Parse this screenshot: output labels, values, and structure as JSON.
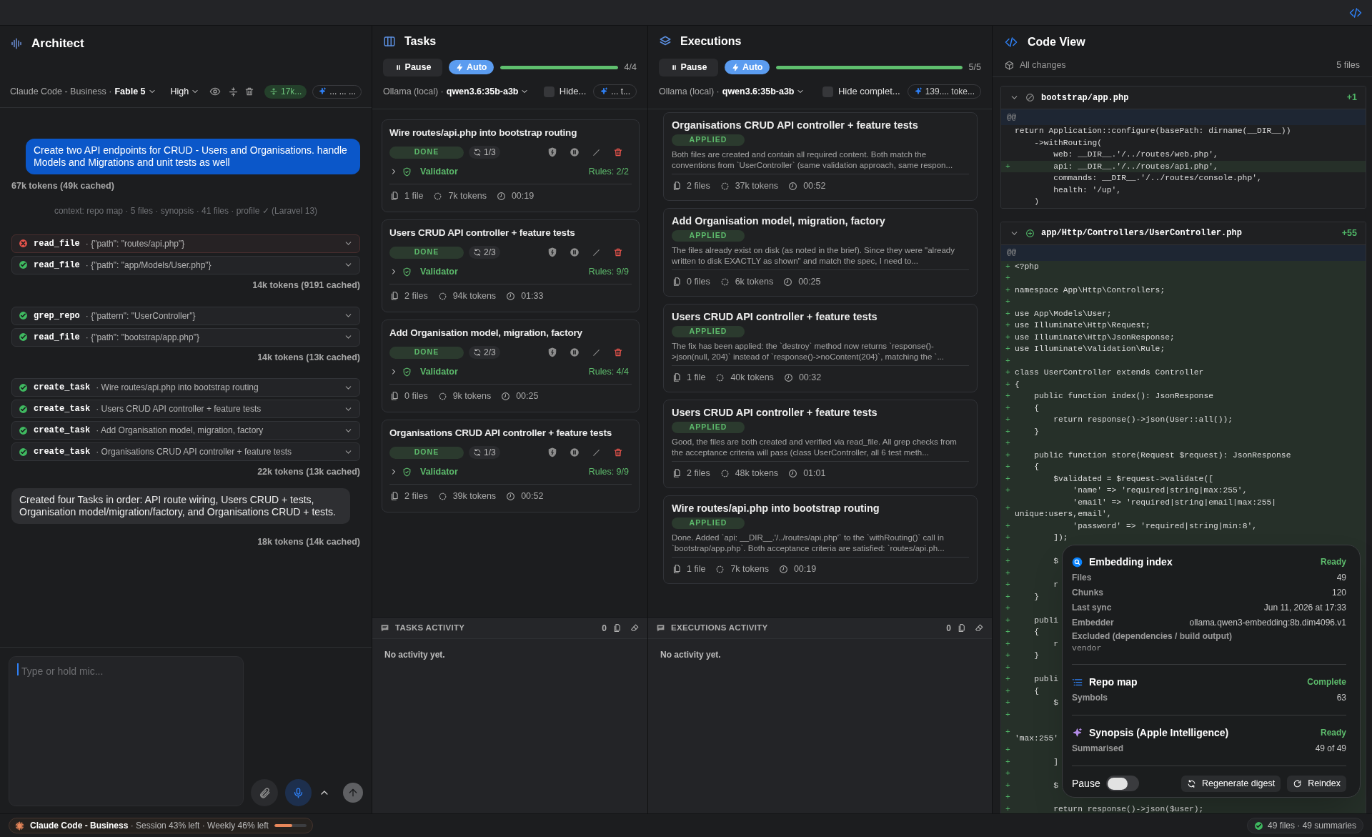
{
  "architect": {
    "title": "Architect",
    "provider": "Claude Code - Business ·",
    "model": "Fable 5",
    "effort": "High",
    "context_pill": "17k...",
    "summary_pill": "... ... ...",
    "messages": [
      {
        "kind": "user",
        "text": "Create two API endpoints for CRUD - Users and Organisations. handle Models and Migrations and unit tests as well",
        "usage": "67k tokens (49k cached)"
      },
      {
        "kind": "context",
        "text": "context: repo map · 5 files · synopsis · 41 files · profile ✓ (Laravel 13)"
      },
      {
        "kind": "tool_group",
        "usage": "14k tokens (9191 cached)",
        "calls": [
          {
            "tool": "read_file",
            "args": "· {\"path\": \"routes/api.php\"}",
            "ok": false
          },
          {
            "tool": "read_file",
            "args": "· {\"path\": \"app/Models/User.php\"}",
            "ok": true
          }
        ]
      },
      {
        "kind": "tool_group",
        "usage": "14k tokens (13k cached)",
        "calls": [
          {
            "tool": "grep_repo",
            "args": "· {\"pattern\": \"UserController\"}",
            "ok": true
          },
          {
            "tool": "read_file",
            "args": "· {\"path\": \"bootstrap/app.php\"}",
            "ok": true
          }
        ]
      },
      {
        "kind": "tool_group",
        "usage": "22k tokens (13k cached)",
        "calls": [
          {
            "tool": "create_task",
            "args": "· Wire routes/api.php into bootstrap routing",
            "ok": true
          },
          {
            "tool": "create_task",
            "args": "· Users CRUD API controller + feature tests",
            "ok": true
          },
          {
            "tool": "create_task",
            "args": "· Add Organisation model, migration, factory",
            "ok": true
          },
          {
            "tool": "create_task",
            "args": "· Organisations CRUD API controller + feature tests",
            "ok": true
          }
        ]
      },
      {
        "kind": "assistant",
        "text": "Created four Tasks in order: API route wiring, Users CRUD + tests, Organisation model/migration/factory, and Organisations CRUD + tests.",
        "usage": "18k tokens (14k cached)"
      }
    ],
    "composer": {
      "placeholder": "Type or hold mic..."
    }
  },
  "tasks": {
    "title": "Tasks",
    "pause": "Pause",
    "auto": {
      "label": "Auto",
      "on": true
    },
    "progress": {
      "level": 1,
      "label": "4/4"
    },
    "provider": "Ollama (local) ·",
    "model": "qwen3.6:35b-a3b",
    "hide": {
      "label": "Hide...",
      "checked": false
    },
    "usage_pill": "... t...",
    "cards": [
      {
        "title": "Wire routes/api.php into bootstrap routing",
        "status": "DONE",
        "attempts": "1/3",
        "validator": "Validator",
        "rules": "Rules: 2/2",
        "files": "1 file",
        "tokens": "7k tokens",
        "time": "00:19"
      },
      {
        "title": "Users CRUD API controller + feature tests",
        "status": "DONE",
        "attempts": "2/3",
        "validator": "Validator",
        "rules": "Rules: 9/9",
        "files": "2 files",
        "tokens": "94k tokens",
        "time": "01:33"
      },
      {
        "title": "Add Organisation model, migration, factory",
        "status": "DONE",
        "attempts": "2/3",
        "validator": "Validator",
        "rules": "Rules: 4/4",
        "files": "0 files",
        "tokens": "9k tokens",
        "time": "00:25"
      },
      {
        "title": "Organisations CRUD API controller + feature tests",
        "status": "DONE",
        "attempts": "1/3",
        "validator": "Validator",
        "rules": "Rules: 9/9",
        "files": "2 files",
        "tokens": "39k tokens",
        "time": "00:52"
      }
    ],
    "activity": {
      "title": "TASKS ACTIVITY",
      "count": "0",
      "empty": "No activity yet."
    }
  },
  "executions": {
    "title": "Executions",
    "pause": "Pause",
    "auto": {
      "label": "Auto",
      "on": true
    },
    "progress": {
      "level": 1,
      "label": "5/5"
    },
    "provider": "Ollama (local) ·",
    "model": "qwen3.6:35b-a3b",
    "hide": {
      "label": "Hide complet...",
      "checked": false
    },
    "usage_pill": "139.... toke...",
    "cards": [
      {
        "title": "Organisations CRUD API controller + feature tests",
        "status": "APPLIED",
        "summary": "Both files are created and contain all required content. Both match the conventions from `UserController` (same validation approach, same respon...",
        "files": "2 files",
        "tokens": "37k tokens",
        "time": "00:52"
      },
      {
        "title": "Add Organisation model, migration, factory",
        "status": "APPLIED",
        "summary": "The files already exist on disk (as noted in the brief). Since they were \"already written to disk EXACTLY as shown\" and match the spec, I need to...",
        "files": "0 files",
        "tokens": "6k tokens",
        "time": "00:25"
      },
      {
        "title": "Users CRUD API controller + feature tests",
        "status": "APPLIED",
        "summary": "The fix has been applied: the `destroy` method now returns `response()->json(null, 204)` instead of `response()->noContent(204)`, matching the `...",
        "files": "1 file",
        "tokens": "40k tokens",
        "time": "00:32"
      },
      {
        "title": "Users CRUD API controller + feature tests",
        "status": "APPLIED",
        "summary": "Good, the files are both created and verified via read_file. All grep checks from the acceptance criteria will pass (class UserController, all 6 test meth...",
        "files": "2 files",
        "tokens": "48k tokens",
        "time": "01:01"
      },
      {
        "title": "Wire routes/api.php into bootstrap routing",
        "status": "APPLIED",
        "summary": "Done. Added `api: __DIR__.'/../routes/api.php'` to the `withRouting()` call in `bootstrap/app.php`. Both acceptance criteria are satisfied: `routes/api.ph...",
        "files": "1 file",
        "tokens": "7k tokens",
        "time": "00:19"
      }
    ],
    "activity": {
      "title": "EXECUTIONS ACTIVITY",
      "count": "0",
      "empty": "No activity yet."
    }
  },
  "code_view": {
    "title": "Code View",
    "scope": "All changes",
    "file_count": "5 files",
    "files": [
      {
        "path": "bootstrap/app.php",
        "kind": "modified",
        "expanded": true,
        "delta": "+1",
        "hunk": "@@",
        "lines": [
          {
            "text": "return Application::configure(basePath: dirname(__DIR__))"
          },
          {
            "text": "    ->withRouting("
          },
          {
            "text": "        web: __DIR__.'/../routes/web.php',"
          },
          {
            "sign": "+",
            "text": "        api: __DIR__.'/../routes/api.php',"
          },
          {
            "text": "        commands: __DIR__.'/../routes/console.php',"
          },
          {
            "text": "        health: '/up',"
          },
          {
            "text": "    )"
          }
        ]
      },
      {
        "path": "app/Http/Controllers/UserController.php",
        "kind": "added",
        "expanded": true,
        "delta": "+55",
        "hunk": "@@",
        "lines": [
          {
            "sign": "+",
            "text": "<?php"
          },
          {
            "sign": "+"
          },
          {
            "sign": "+",
            "text": "namespace App\\Http\\Controllers;"
          },
          {
            "sign": "+"
          },
          {
            "sign": "+",
            "text": "use App\\Models\\User;"
          },
          {
            "sign": "+",
            "text": "use Illuminate\\Http\\Request;"
          },
          {
            "sign": "+",
            "text": "use Illuminate\\Http\\JsonResponse;"
          },
          {
            "sign": "+",
            "text": "use Illuminate\\Validation\\Rule;"
          },
          {
            "sign": "+"
          },
          {
            "sign": "+",
            "text": "class UserController extends Controller"
          },
          {
            "sign": "+",
            "text": "{"
          },
          {
            "sign": "+",
            "text": "    public function index(): JsonResponse"
          },
          {
            "sign": "+",
            "text": "    {"
          },
          {
            "sign": "+",
            "text": "        return response()->json(User::all());"
          },
          {
            "sign": "+",
            "text": "    }"
          },
          {
            "sign": "+"
          },
          {
            "sign": "+",
            "text": "    public function store(Request $request): JsonResponse"
          },
          {
            "sign": "+",
            "text": "    {"
          },
          {
            "sign": "+",
            "text": "        $validated = $request->validate(["
          },
          {
            "sign": "+",
            "text": "            'name' => 'required|string|max:255',"
          },
          {
            "sign": "+",
            "text": "            'email' => 'required|string|email|max:255|unique:users,email',"
          },
          {
            "sign": "+",
            "text": "            'password' => 'required|string|min:8',"
          },
          {
            "sign": "+",
            "text": "        ]);"
          },
          {
            "sign": "+"
          },
          {
            "sign": "+",
            "text": "        $"
          },
          {
            "sign": "+"
          },
          {
            "sign": "+",
            "text": "        r"
          },
          {
            "sign": "+",
            "text": "    }"
          },
          {
            "sign": "+"
          },
          {
            "sign": "+",
            "text": "    publi"
          },
          {
            "sign": "+",
            "text": "    {"
          },
          {
            "sign": "+",
            "text": "        r"
          },
          {
            "sign": "+",
            "text": "    }"
          },
          {
            "sign": "+"
          },
          {
            "sign": "+",
            "text": "    publi"
          },
          {
            "sign": "+",
            "text": "    {"
          },
          {
            "sign": "+",
            "text": "        $"
          },
          {
            "sign": "+"
          },
          {
            "sign": "+",
            "text": "'max:255'",
            "wrapped": true
          },
          {
            "sign": "+"
          },
          {
            "sign": "+",
            "text": "        ]"
          },
          {
            "sign": "+"
          },
          {
            "sign": "+",
            "text": "        $"
          },
          {
            "sign": "+"
          },
          {
            "sign": "+",
            "text": "        return response()->json($user);"
          }
        ]
      }
    ]
  },
  "index_popover": {
    "sections": [
      {
        "kind": "embedding",
        "title": "Embedding index",
        "status": "Ready",
        "rows": [
          {
            "label": "Files",
            "value": "49"
          },
          {
            "label": "Chunks",
            "value": "120"
          },
          {
            "label": "Last sync",
            "value": "Jun 11, 2026 at 17:33"
          },
          {
            "label": "Embedder",
            "value": "ollama.qwen3-embedding:8b.dim4096.v1"
          }
        ],
        "excluded_label": "Excluded (dependencies / build output)",
        "excluded": "vendor"
      },
      {
        "kind": "repo_map",
        "title": "Repo map",
        "status": "Complete",
        "rows": [
          {
            "label": "Symbols",
            "value": "63"
          }
        ]
      },
      {
        "kind": "synopsis",
        "title": "Synopsis (Apple Intelligence)",
        "status": "Ready",
        "rows": [
          {
            "label": "Summarised",
            "value": "49 of 49"
          }
        ]
      }
    ],
    "pause_label": "Pause",
    "paused": false,
    "actions": [
      {
        "kind": "regenerate",
        "label": "Regenerate digest"
      },
      {
        "kind": "reindex",
        "label": "Reindex"
      }
    ]
  },
  "status_bar": {
    "usage": "**Claude Code - Business** · Session 43% left · Weekly 46% left",
    "level": 0.55,
    "index": "49 files · 49 summaries"
  }
}
